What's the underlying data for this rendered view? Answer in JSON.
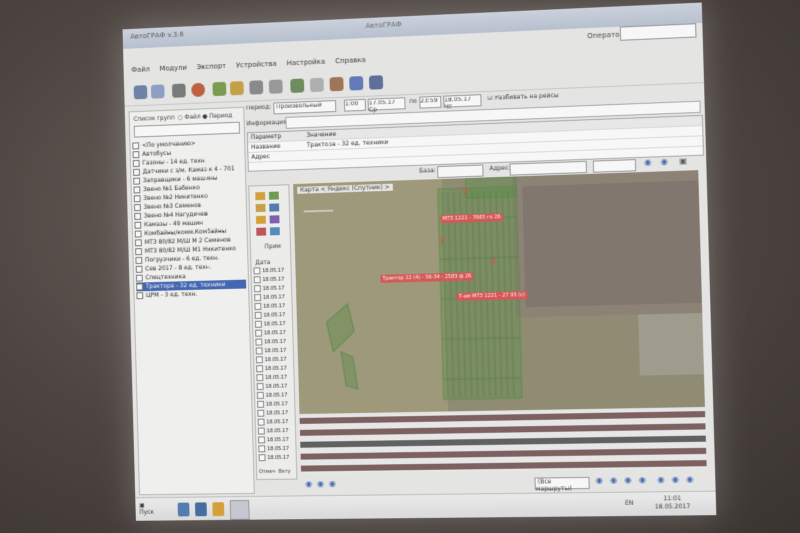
{
  "window": {
    "title": "АвтоГРАФ v.3.6",
    "center_title": "АвтоГРАФ"
  },
  "operator": {
    "label": "Оператор:",
    "value": ""
  },
  "menu": [
    "Файл",
    "Модули",
    "Экспорт",
    "Устройства",
    "Настройка",
    "Справка"
  ],
  "period_bar": {
    "period_label": "Период:",
    "period_value": "Произвольный",
    "start_time": "1:00",
    "start_date": "17.05.17 Ср",
    "end_label": "по",
    "end_time": "23:59",
    "end_date": "18.05.17 Чт",
    "split_label": "Разбивать на рейсы"
  },
  "left_panel": {
    "header": "Список групп",
    "radio_file": "Файл",
    "radio_period": "Период",
    "tree": [
      "<По умолчанию>",
      "Автобусы",
      "Газоны - 14 ед. техн.",
      "Датчики с з/м. Камаз к 4 - 701",
      "Заправщики - 6 машины",
      "Звено №1 Бабенко",
      "Звено №2 Никитенко",
      "Звено №3 Семенов",
      "Звено №4 Нагудечев",
      "Камазы - 49 машин",
      "Комбайны/комм.Комбайны",
      "МТЗ 80/82 М/Ш М 2 Семенов",
      "МТЗ 80/82 М/Ш М1 Никитенко",
      "Погрузчики - 6 ед. техн.",
      "Сев 2017 - 8 ед. техн.",
      "Спецтехника",
      "Трактора - 32 ед. техники",
      "ЦРМ - 3 ед. техн."
    ],
    "selected_index": 16
  },
  "info": {
    "label": "Информация о группе:"
  },
  "params": {
    "col_param": "Параметр",
    "col_value": "Значение",
    "rows": [
      {
        "param": "Название",
        "value": "Трактора - 32 ед. техники"
      },
      {
        "param": "Адрес",
        "value": ""
      }
    ]
  },
  "filter_bar": {
    "base_label": "База:",
    "address_label": "Адрес:"
  },
  "side_strip": {
    "print_label": "Прим",
    "date_header": "Дата",
    "dates": [
      "18.05.17",
      "18.05.17",
      "18.05.17",
      "18.05.17",
      "18.05.17",
      "18.05.17",
      "18.05.17",
      "18.05.17",
      "18.05.17",
      "18.05.17",
      "18.05.17",
      "18.05.17",
      "18.05.17",
      "18.05.17",
      "18.05.17",
      "18.05.17",
      "18.05.17",
      "18.05.17",
      "18.05.17",
      "18.05.17",
      "18.05.17",
      "18.05.17"
    ],
    "bottom_left": "Отмеч",
    "bottom_right": "Вкту"
  },
  "map": {
    "caption": "Карта  < Яндекс (Спутник) >",
    "labels": [
      "МТЗ 1221 - 7665 го 26",
      "Трактор 22 (4) - 56-34 - 2583 ф 26",
      "Т-ам МТЗ 1221 - 27 93 (с)"
    ]
  },
  "bottom_bar": {
    "routes_value": "(Все маршруты)"
  },
  "taskbar": {
    "start_label": "Пуск",
    "lang": "EN",
    "time": "11:01",
    "date": "18.05.2017"
  },
  "colors": {
    "selection": "#3d62b3",
    "map_label": "#d9534f",
    "field_green": "#4f8a3f",
    "track": "#7a5c5c"
  }
}
